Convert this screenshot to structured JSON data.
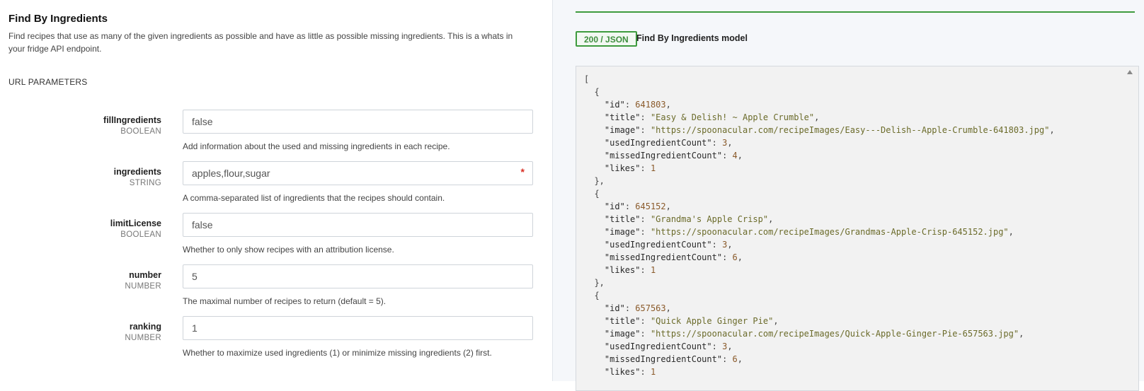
{
  "endpoint": {
    "title": "Find By Ingredients",
    "description": "Find recipes that use as many of the given ingredients as possible and have as little as possible missing ingredients. This is a whats in your fridge API endpoint."
  },
  "params_section_label": "URL PARAMETERS",
  "params": [
    {
      "name": "fillIngredients",
      "type": "BOOLEAN",
      "value": "false",
      "required": false,
      "help": "Add information about the used and missing ingredients in each recipe."
    },
    {
      "name": "ingredients",
      "type": "STRING",
      "value": "apples,flour,sugar",
      "required": true,
      "help": "A comma-separated list of ingredients that the recipes should contain."
    },
    {
      "name": "limitLicense",
      "type": "BOOLEAN",
      "value": "false",
      "required": false,
      "help": "Whether to only show recipes with an attribution license."
    },
    {
      "name": "number",
      "type": "NUMBER",
      "value": "5",
      "required": false,
      "help": "The maximal number of recipes to return (default = 5)."
    },
    {
      "name": "ranking",
      "type": "NUMBER",
      "value": "1",
      "required": false,
      "help": "Whether to maximize used ingredients (1) or minimize missing ingredients (2) first."
    }
  ],
  "required_marker": "*",
  "response": {
    "status_badge": "200 / JSON",
    "model_name": "Find By Ingredients model",
    "code_lines": [
      "[",
      "  {",
      "    \"id\": 641803,",
      "    \"title\": \"Easy & Delish! ~ Apple Crumble\",",
      "    \"image\": \"https://spoonacular.com/recipeImages/Easy---Delish--Apple-Crumble-641803.jpg\",",
      "    \"usedIngredientCount\": 3,",
      "    \"missedIngredientCount\": 4,",
      "    \"likes\": 1",
      "  },",
      "  {",
      "    \"id\": 645152,",
      "    \"title\": \"Grandma's Apple Crisp\",",
      "    \"image\": \"https://spoonacular.com/recipeImages/Grandmas-Apple-Crisp-645152.jpg\",",
      "    \"usedIngredientCount\": 3,",
      "    \"missedIngredientCount\": 6,",
      "    \"likes\": 1",
      "  },",
      "  {",
      "    \"id\": 657563,",
      "    \"title\": \"Quick Apple Ginger Pie\",",
      "    \"image\": \"https://spoonacular.com/recipeImages/Quick-Apple-Ginger-Pie-657563.jpg\",",
      "    \"usedIngredientCount\": 3,",
      "    \"missedIngredientCount\": 6,",
      "    \"likes\": 1"
    ]
  },
  "colors": {
    "success_green": "#3e9b3e",
    "required_red": "#d93025"
  }
}
